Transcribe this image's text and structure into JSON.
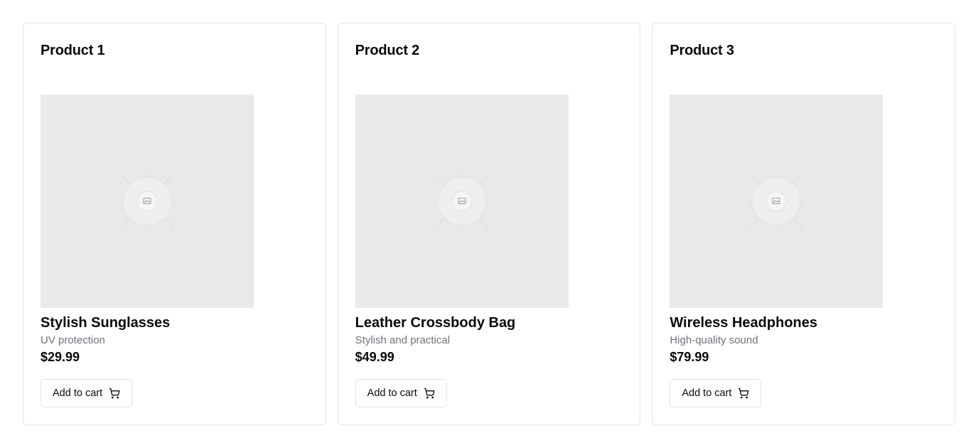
{
  "products": [
    {
      "header": "Product 1",
      "name": "Stylish Sunglasses",
      "description": "UV protection",
      "price": "$29.99",
      "button_label": "Add to cart",
      "image_icon": "image-placeholder-icon",
      "button_icon": "shopping-cart-icon"
    },
    {
      "header": "Product 2",
      "name": "Leather Crossbody Bag",
      "description": "Stylish and practical",
      "price": "$49.99",
      "button_label": "Add to cart",
      "image_icon": "image-placeholder-icon",
      "button_icon": "shopping-cart-icon"
    },
    {
      "header": "Product 3",
      "name": "Wireless Headphones",
      "description": "High-quality sound",
      "price": "$79.99",
      "button_label": "Add to cart",
      "image_icon": "image-placeholder-icon",
      "button_icon": "shopping-cart-icon"
    }
  ],
  "colors": {
    "card_border": "#e4e4e7",
    "image_placeholder": "#e9e9e9",
    "muted_text": "#71717a",
    "text": "#0a0a0a"
  }
}
